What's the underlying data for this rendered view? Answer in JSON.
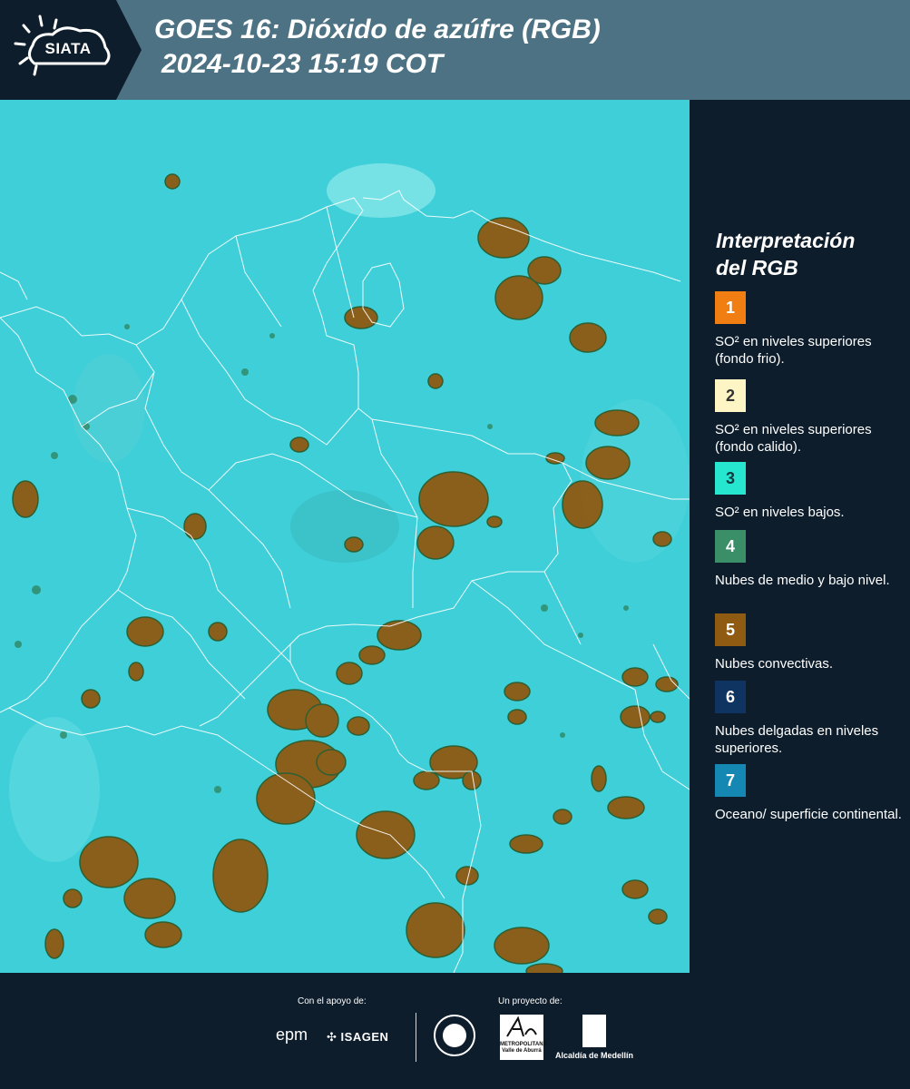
{
  "header": {
    "logo_text": "SIATA",
    "title_line1": "GOES 16: Dióxido de azúfre (RGB)",
    "title_line2": "2024-10-23 15:19 COT"
  },
  "legend": {
    "title_line1": "Interpretación",
    "title_line2": "del RGB",
    "items": [
      {
        "number": "1",
        "color": "#f07e12",
        "text_color": "#ffffff",
        "text": "SO² en niveles superiores (fondo frio)."
      },
      {
        "number": "2",
        "color": "#fdf6c4",
        "text_color": "#333333",
        "text": "SO² en niveles superiores (fondo calido)."
      },
      {
        "number": "3",
        "color": "#27e6d0",
        "text_color": "#0d3a40",
        "text": "SO² en niveles bajos."
      },
      {
        "number": "4",
        "color": "#3a8e68",
        "text_color": "#ffffff",
        "text": "Nubes de medio y bajo nivel."
      },
      {
        "number": "5",
        "color": "#8f5a12",
        "text_color": "#ffffff",
        "text": "Nubes convectivas."
      },
      {
        "number": "6",
        "color": "#0f3461",
        "text_color": "#ffffff",
        "text": "Nubes delgadas en niveles superiores."
      },
      {
        "number": "7",
        "color": "#1488b2",
        "text_color": "#ffffff",
        "text": "Oceano/ superficie continental."
      }
    ]
  },
  "footer": {
    "support_label": "Con el apoyo de:",
    "project_label": "Un proyecto de:",
    "sponsor_epm": "epm",
    "sponsor_isagen": "ISAGEN",
    "amva_line1": "METROPOLITANA",
    "amva_line2": "Valle de Aburrá",
    "alcaldia": "Alcaldía de Medellín"
  },
  "colors": {
    "header_bg": "#4c7283",
    "logo_bg": "#0d1d2b",
    "map_background": "#3ecfd8",
    "convective_cloud": "#8f5a12",
    "borders": "#ffffff"
  }
}
